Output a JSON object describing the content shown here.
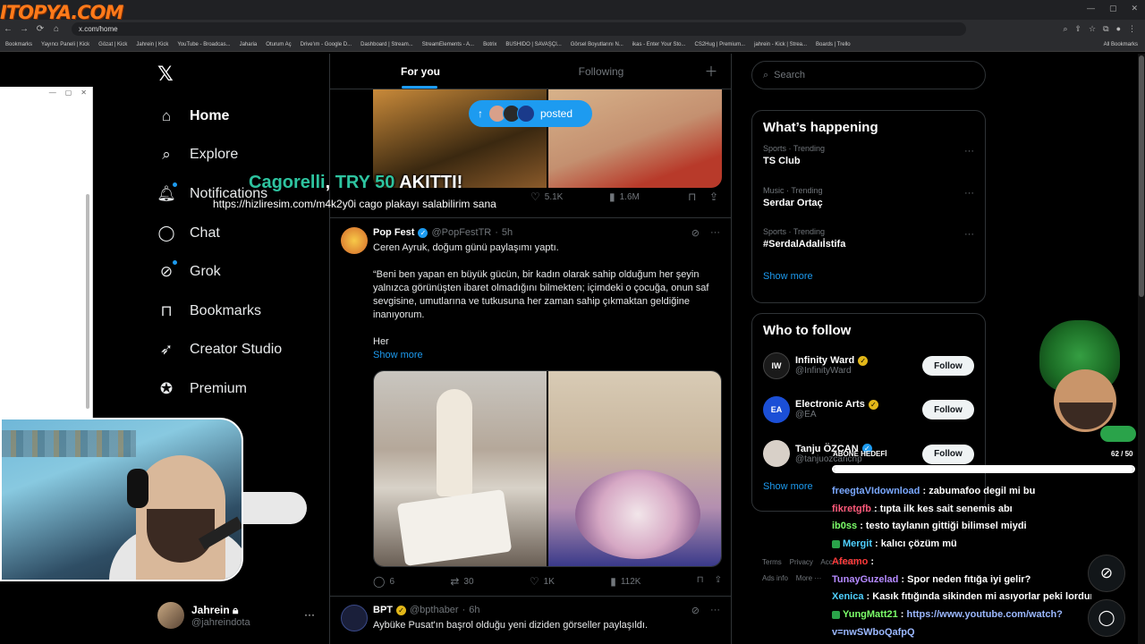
{
  "brand": {
    "logo_text": "ITOPYA.COM"
  },
  "browser": {
    "url": "x.com/home",
    "bookmarks": [
      "Bookmarks",
      "Yayıncı Paneli | Kick",
      "Gözat | Kick",
      "Jahrein | Kick",
      "YouTube - Broadcas...",
      "Jaharia",
      "Oturum Aç",
      "Drive'ım - Google D...",
      "Dashboard | Stream...",
      "StreamElements - A...",
      "Botrix",
      "BUSHIDO | SAVAŞÇI...",
      "Görsel Boyutlarını N...",
      "ikas - Enter Your Sto...",
      "CS2Hug | Premium...",
      "jahrein - Kick | Strea...",
      "Boards | Trello"
    ],
    "all_bookmarks": "All Bookmarks"
  },
  "sidebar": {
    "items": [
      {
        "label": "Home",
        "icon": "home-icon",
        "active": true
      },
      {
        "label": "Explore",
        "icon": "search-icon"
      },
      {
        "label": "Notifications",
        "icon": "bell-icon",
        "dot": true
      },
      {
        "label": "Chat",
        "icon": "chat-icon"
      },
      {
        "label": "Grok",
        "icon": "grok-icon"
      },
      {
        "label": "Bookmarks",
        "icon": "bookmark-icon"
      },
      {
        "label": "Creator Studio",
        "icon": "rocket-icon"
      },
      {
        "label": "Premium",
        "icon": "premium-icon"
      }
    ],
    "account": {
      "name": "Jahrein",
      "handle": "@jahreindota"
    }
  },
  "feed": {
    "tabs": [
      "For you",
      "Following"
    ],
    "posted_pill": "posted",
    "first_metrics": {
      "likes": "5.1K",
      "views": "1.6M"
    },
    "tweets": [
      {
        "name": "Pop Fest",
        "handle": "@PopFestTR",
        "time": "5h",
        "line1": "Ceren Ayruk, doğum günü paylaşımı yaptı.",
        "line2": "“Beni ben yapan en büyük gücün, bir kadın olarak sahip olduğum her şeyin yalnızca görünüşten ibaret olmadığını bilmekten; içimdeki o çocuğa, onun saf sevgisine, umutlarına ve tutkusuna her zaman sahip çıkmaktan geldiğine inanıyorum.",
        "line3": "Her",
        "show_more": "Show more",
        "replies": "6",
        "reposts": "30",
        "likes": "1K",
        "views": "112K"
      },
      {
        "name": "BPT",
        "handle": "@bpthaber",
        "time": "6h",
        "line1": "Aybüke Pusat'ın başrol olduğu yeni diziden görseller paylaşıldı."
      }
    ]
  },
  "right": {
    "search_placeholder": "Search",
    "whats_happening": "What’s happening",
    "trends": [
      {
        "category": "Sports · Trending",
        "name": "TS Club"
      },
      {
        "category": "Music · Trending",
        "name": "Serdar Ortaç"
      },
      {
        "category": "Sports · Trending",
        "name": "#SerdalAdalıİstifa"
      }
    ],
    "show_more": "Show more",
    "who_to_follow": "Who to follow",
    "follows": [
      {
        "name": "Infinity Ward",
        "handle": "@InfinityWard",
        "avatar_text": "IW",
        "avatar_color": "#1a1a1a"
      },
      {
        "name": "Electronic Arts",
        "handle": "@EA",
        "avatar_text": "EA",
        "avatar_color": "#1b4fd6"
      },
      {
        "name": "Tanju ÖZCAN",
        "handle": "@tanjuozcanchp",
        "avatar_text": "",
        "avatar_color": "#d8d0c8"
      }
    ],
    "follow_label": "Follow",
    "footer": [
      "Terms",
      "Privacy",
      "Accessibility",
      "Ads info",
      "More ···"
    ]
  },
  "stream": {
    "alert_name": "Cagorelli",
    "alert_amount": "TRY 50",
    "alert_rest": "AKITTI!",
    "alert_message": "https://hizliresim.com/m4k2y0i cago plakayı salabilirim sana",
    "sub_goal_label": "ABONE HEDEFİ",
    "sub_goal_count": "62 / 50",
    "sub_goal_progress": 1.0,
    "chat": [
      {
        "user": "freegtaVIdownload",
        "color": "#7aa8ff",
        "msg": "zabumafoo degil mi bu"
      },
      {
        "user": "fikretgfb",
        "color": "#ff5a7a",
        "msg": "tıpta ilk kes sait senemis abı"
      },
      {
        "user": "ib0ss",
        "color": "#7cff6a",
        "msg": "testo taylanın gittiği bilimsel miydi"
      },
      {
        "user": "Mergit",
        "color": "#4fd0ff",
        "msg": "kalıcı çözüm mü",
        "badge": "#2aa34a"
      },
      {
        "user": "Afeamo",
        "color": "#ff3a3a",
        "msg": ""
      },
      {
        "user": "TunayGuzelad",
        "color": "#b58aff",
        "msg": "Spor neden fıtığa iyi gelir?"
      },
      {
        "user": "Xenica",
        "color": "#4fd0ff",
        "msg": "Kasık fıtığında sikinden mi asıyorlar peki lordum"
      },
      {
        "user": "YungMatt21",
        "color": "#7cff6a",
        "msg": "",
        "link": "https://www.youtube.com/watch?",
        "badge": "#2aa34a"
      },
      {
        "user": "",
        "color": "#9bb8ff",
        "msg": "",
        "link": "v=nwSWboQafpQ"
      }
    ]
  }
}
